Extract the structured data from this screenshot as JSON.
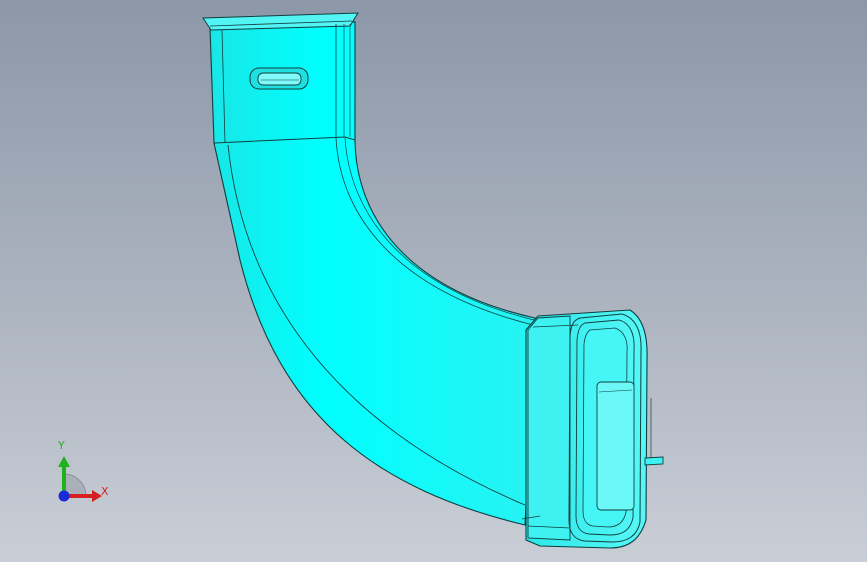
{
  "viewport": {
    "background_top": "#8c97a8",
    "background_bottom": "#c9ced6"
  },
  "part": {
    "body_color": "#00ffff",
    "edge_color": "#0f3f3f",
    "features": [
      "rectangular-duct-top",
      "slot-hole",
      "elbow-bend",
      "rounded-flange-end",
      "side-tab"
    ]
  },
  "triad": {
    "x_label": "X",
    "y_label": "Y",
    "x_color": "#d42020",
    "y_color": "#1fb21f",
    "z_color": "#1a2cd8"
  }
}
